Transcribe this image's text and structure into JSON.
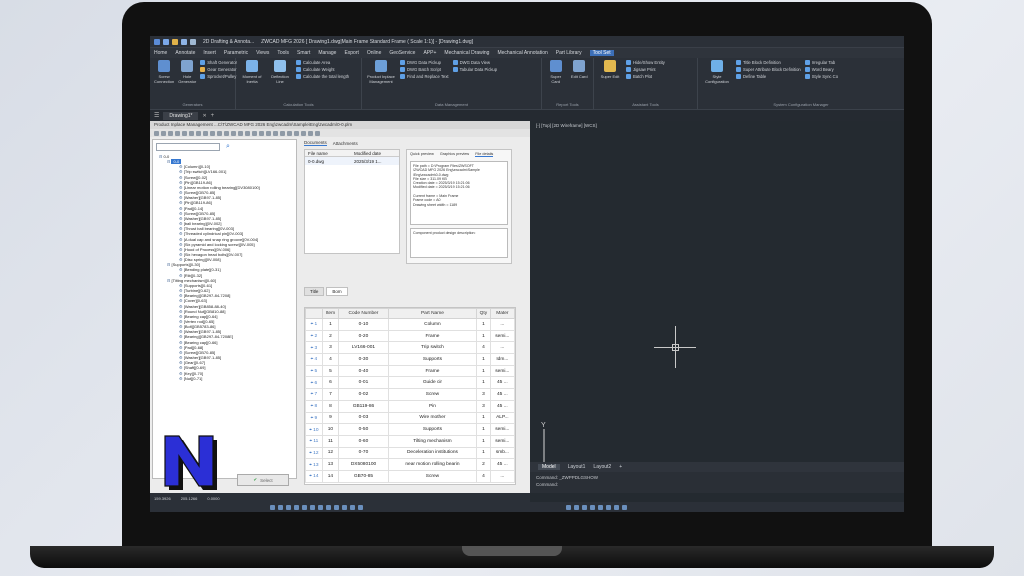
{
  "window": {
    "title": "ZWCAD MFG 2026 [ Drawing1.dwg|Main Frame  Standard Frame ( Scale 1:1)]  - [Drawing1.dwg]",
    "workspace": "2D Drafting & Annota..."
  },
  "menu": [
    "Home",
    "Annotate",
    "Insert",
    "Parametric",
    "Views",
    "Tools",
    "Smart",
    "Manage",
    "Export",
    "Online",
    "GeoService",
    "APP+",
    "Mechanical Drawing",
    "Mechanical Annotation",
    "Part Library",
    "Tool Set"
  ],
  "ribbon": {
    "generators": {
      "big": [
        "Screw Connection",
        "Hole Generator"
      ],
      "small": [
        "Shaft Generator",
        "Gear Generator",
        "Sprocket/Pulley"
      ],
      "label": "Generators"
    },
    "calc": {
      "big": [
        "Moment of Inertia",
        "Deflection Line"
      ],
      "small": [
        "Calculate Area",
        "Calculate Weight",
        "Calculate the total length"
      ],
      "label": "Calculation Tools"
    },
    "data": {
      "big": [
        "Product Inplace Management"
      ],
      "small": [
        "DWG Data Pickup",
        "DWG Batch Script",
        "Find and Replace Text",
        "DWG Data View",
        "Tabular Data Pickup"
      ],
      "label": "Data Management"
    },
    "report": {
      "big": [
        "Super Card",
        "Edit Card"
      ],
      "label": "Report Tools"
    },
    "assistant": {
      "big": [
        "Super Edit"
      ],
      "small": [
        "Hide/Show Entity",
        "Jigsaw Print",
        "Batch Plot"
      ],
      "label": "Assistant Tools"
    },
    "config": {
      "big": [
        "Style Configuration"
      ],
      "small": [
        "Title Block Definition",
        "Super Attribute Block Definition",
        "Define Table",
        "Irregular Tab",
        "Word Beary",
        "Style Sync Co"
      ],
      "label": "System Configuration Manager"
    }
  },
  "doc_tab": "Drawing1*",
  "panel": {
    "title": "Product Inplace Management  ...C\\T\\ZWCAD MFG 2026 Eng\\zwcadm\\Sample\\Eng\\zwcadm\\0-0.plm",
    "tree": [
      {
        "level": 0,
        "text": "0-0"
      },
      {
        "level": 1,
        "text": "0-0",
        "selected": true
      },
      {
        "level": 2,
        "text": "[Column][0-10]"
      },
      {
        "level": 2,
        "text": "[Trip switch][LV166-001]"
      },
      {
        "level": 2,
        "text": "[Screw][0-02]"
      },
      {
        "level": 2,
        "text": "[Pin][GB119-86]"
      },
      {
        "level": 2,
        "text": "[Linear motion rolling bearing][DV3080100]"
      },
      {
        "level": 2,
        "text": "[Screw][GB70-85]"
      },
      {
        "level": 2,
        "text": "[Washer][GB97.1-85]"
      },
      {
        "level": 2,
        "text": "[Pin][GB119-86]"
      },
      {
        "level": 2,
        "text": "[Pad][0-14]"
      },
      {
        "level": 2,
        "text": "[Screw][GB70-85]"
      },
      {
        "level": 2,
        "text": "[Washer][GB97.1-85]"
      },
      {
        "level": 2,
        "text": "[ball bearing][0V-002]"
      },
      {
        "level": 2,
        "text": "[Thrust ball bearing][0V-003]"
      },
      {
        "level": 2,
        "text": "[Threaded cylindrical pin][0V-003]"
      },
      {
        "level": 2,
        "text": "[A dual cap and snap ring groove][0V-004]"
      },
      {
        "level": 2,
        "text": "[Six pyramid and locking screw][0V-005]"
      },
      {
        "level": 2,
        "text": "[Hood of Process][0V-006]"
      },
      {
        "level": 2,
        "text": "[Six hexagon head bolts][0V-007]"
      },
      {
        "level": 2,
        "text": "[Disc spring][0V-008]"
      },
      {
        "level": 1,
        "text": "[Supports][0-30]"
      },
      {
        "level": 2,
        "text": "[Bending plate][0-31]"
      },
      {
        "level": 2,
        "text": "[Rib][0-32]"
      },
      {
        "level": 1,
        "text": "[Tilting mechanism][0-60]"
      },
      {
        "level": 2,
        "text": "[Supports][0-61]"
      },
      {
        "level": 2,
        "text": "[Turbine][0-62]"
      },
      {
        "level": 2,
        "text": "[Bearing][GB297-84-7208]"
      },
      {
        "level": 2,
        "text": "[Cover][0-63]"
      },
      {
        "level": 2,
        "text": "[Washer][GB858-88-40]"
      },
      {
        "level": 2,
        "text": "[Round Nut][GB810-88]"
      },
      {
        "level": 2,
        "text": "[Bearing cap][0-64]"
      },
      {
        "level": 2,
        "text": "[Vertex rod][0-65]"
      },
      {
        "level": 2,
        "text": "[Bolt][GB5783-86]"
      },
      {
        "level": 2,
        "text": "[Washer][GB97.1-85]"
      },
      {
        "level": 2,
        "text": "[Bearing][GB297-84-7208E]"
      },
      {
        "level": 2,
        "text": "[Bearing cap][0-66]"
      },
      {
        "level": 2,
        "text": "[Pad][0-68]"
      },
      {
        "level": 2,
        "text": "[Screw][GB70-85]"
      },
      {
        "level": 2,
        "text": "[Washer][GB97.1-85]"
      },
      {
        "level": 2,
        "text": "[Gear][0-67]"
      },
      {
        "level": 2,
        "text": "[Shaft][0-69]"
      },
      {
        "level": 2,
        "text": "[Key][0-70]"
      },
      {
        "level": 2,
        "text": "[Nut][0-71]"
      }
    ],
    "doc_tabs": [
      "Documents",
      "Attachments"
    ],
    "file_headers": [
      "File name",
      "Modified date"
    ],
    "files": [
      {
        "name": "0-0.dwg",
        "date": "2025/3/19 1..."
      }
    ],
    "preview_tabs": [
      "Quick preview",
      "Graphics preview",
      "File details"
    ],
    "details": [
      "File path = D:\\Program Files\\ZWSOFT",
      "\\ZWCAD MFG 2026 Eng\\zwcadm\\Sample",
      "\\Eng\\zwcadm\\0-0.dwg",
      "File size = 311.09 KB",
      "Creation date = 2025/3/19 15:21:06",
      "Modified date = 2025/3/19 15:21:06",
      "",
      "Current frame = Main Frame",
      "Frame code = A0",
      "Drawing sheet width = 1189"
    ],
    "desc_label": "Component product design description:",
    "bom_tabs": [
      "Title",
      "Bom"
    ],
    "bom_headers": [
      "",
      "Item",
      "Code Number",
      "Part Name",
      "Qty",
      "Mater"
    ],
    "bom_rows": [
      [
        "1",
        "1",
        "0-10",
        "Column",
        "1",
        "..."
      ],
      [
        "2",
        "2",
        "0-20",
        "Frame",
        "1",
        "semi..."
      ],
      [
        "3",
        "3",
        "LV166-001",
        "Trip switch",
        "4",
        "..."
      ],
      [
        "4",
        "4",
        "0-30",
        "Supports",
        "1",
        "Idm..."
      ],
      [
        "5",
        "5",
        "0-40",
        "Frame",
        "1",
        "semi..."
      ],
      [
        "6",
        "6",
        "0-01",
        "Guide cir",
        "1",
        "45 ..."
      ],
      [
        "7",
        "7",
        "0-02",
        "Screw",
        "3",
        "45 ..."
      ],
      [
        "8",
        "8",
        "GB119-86",
        "Pin",
        "3",
        "45 ..."
      ],
      [
        "9",
        "9",
        "0-03",
        "Wire mother",
        "1",
        "ALP..."
      ],
      [
        "10",
        "10",
        "0-50",
        "Supports",
        "1",
        "semi..."
      ],
      [
        "11",
        "11",
        "0-60",
        "Tilting mechanism",
        "1",
        "semi..."
      ],
      [
        "12",
        "12",
        "0-70",
        "Deceleration institutions",
        "1",
        "smb..."
      ],
      [
        "13",
        "13",
        "DX5080100",
        "near motion rolling bearin",
        "2",
        "45 ..."
      ],
      [
        "14",
        "14",
        "GB70-85",
        "Screw",
        "4",
        "..."
      ]
    ],
    "select_label": "Select",
    "status": [
      "159.3926",
      "205.1266",
      "0.0000"
    ]
  },
  "canvas": {
    "view_label": "[-] [Top] [2D Wireframe] [WCS]",
    "layout_tabs": [
      "Model",
      "Layout1",
      "Layout2",
      "+"
    ],
    "cmd_lines": [
      "Command: _ZWPPDLGSHOW",
      "Command:"
    ],
    "axis_x": "X",
    "axis_y": "Y"
  },
  "colors": {
    "accent": "#3778d0",
    "canvas_bg": "#242a30",
    "logo_fill": "#2b2fd6"
  }
}
